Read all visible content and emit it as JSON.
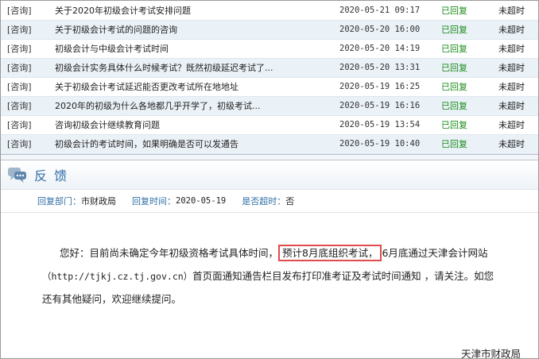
{
  "rows": [
    {
      "category": "[咨询]",
      "title": "关于2020年初级会计考试安排问题",
      "date": "2020-05-21 09:17",
      "status": "已回复",
      "overdue": "未超时"
    },
    {
      "category": "[咨询]",
      "title": "关于初级会计考试的问题的咨询",
      "date": "2020-05-20 16:00",
      "status": "已回复",
      "overdue": "未超时"
    },
    {
      "category": "[咨询]",
      "title": "初级会计与中级会计考试时间",
      "date": "2020-05-20 14:19",
      "status": "已回复",
      "overdue": "未超时"
    },
    {
      "category": "[咨询]",
      "title": "初级会计实务具体什么时候考试？既然初级延迟考试了...",
      "date": "2020-05-20 13:31",
      "status": "已回复",
      "overdue": "未超时"
    },
    {
      "category": "[咨询]",
      "title": "关于初级会计考试延迟能否更改考试所在地地址",
      "date": "2020-05-19 16:25",
      "status": "已回复",
      "overdue": "未超时"
    },
    {
      "category": "[咨询]",
      "title": "2020年的初级为什么各地都几乎开学了，初级考试...",
      "date": "2020-05-19 16:16",
      "status": "已回复",
      "overdue": "未超时"
    },
    {
      "category": "[咨询]",
      "title": "咨询初级会计继续教育问题",
      "date": "2020-05-19 13:54",
      "status": "已回复",
      "overdue": "未超时"
    },
    {
      "category": "[咨询]",
      "title": "初级会计的考试时间，如果明确是否可以发通告",
      "date": "2020-05-19 10:40",
      "status": "已回复",
      "overdue": "未超时"
    }
  ],
  "feedback": {
    "title": "反 馈",
    "dept_label": "回复部门：",
    "dept": "市财政局",
    "time_label": "回复时间：",
    "time": "2020-05-19",
    "overdue_label": "是否超时：",
    "overdue": "否",
    "line1_a": "您好：目前尚未确定今年初级资格考试具体时间，",
    "line1_hl": "预计8月底组织考试，",
    "line1_b": "6月底通过天津会计网站",
    "line2_url": "（http://tjkj.cz.tj.gov.cn）",
    "line2_b": "首页面通知通告栏目发布打印准考证及考试时间通知 ，请关注。如您",
    "line3": "还有其他疑问，欢迎继续提问。",
    "signature": "天津市财政局"
  },
  "colors": {
    "link": "#2f6ea5",
    "replied": "#1a8a1a",
    "highlight": "#e04b4b"
  },
  "icons": {
    "feedback": "chat-bubble-icon"
  }
}
